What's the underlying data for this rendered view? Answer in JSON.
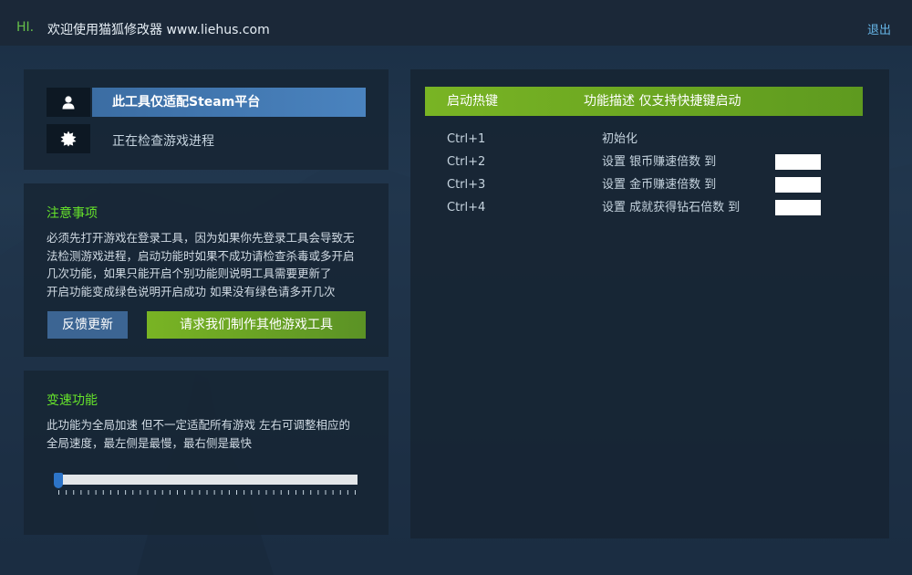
{
  "titlebar": {
    "greeting": "HI.",
    "welcome": "欢迎使用猫狐修改器 www.liehus.com",
    "exit": "退出"
  },
  "status": {
    "title": "此工具仅适配Steam平台",
    "checking": "正在检查游戏进程",
    "icons": [
      "user-icon",
      "gear-icon"
    ]
  },
  "notes": {
    "heading": "注意事项",
    "lines": [
      "必须先打开游戏在登录工具，因为如果你先登录工具会导致无",
      "法检测游戏进程，启动功能时如果不成功请检查杀毒或多开启",
      "几次功能，如果只能开启个别功能则说明工具需要更新了",
      "开启功能变成绿色说明开启成功 如果没有绿色请多开几次"
    ],
    "feedback_button": "反馈更新",
    "request_button": "请求我们制作其他游戏工具"
  },
  "speed": {
    "heading": "变速功能",
    "lines": [
      "此功能为全局加速 但不一定适配所有游戏 左右可调整相应的",
      "全局速度，最左侧是最慢，最右侧是最快"
    ],
    "slider_value": 0
  },
  "hotkeys": {
    "col_key": "启动热键",
    "col_desc": "功能描述 仅支持快捷键启动",
    "rows": [
      {
        "key": "Ctrl+1",
        "desc": "初始化",
        "has_input": false
      },
      {
        "key": "Ctrl+2",
        "desc": "设置 银币赚速倍数 到",
        "has_input": true
      },
      {
        "key": "Ctrl+3",
        "desc": "设置 金币赚速倍数 到",
        "has_input": true
      },
      {
        "key": "Ctrl+4",
        "desc": "设置 成就获得钻石倍数 到",
        "has_input": true
      }
    ]
  },
  "colors": {
    "accent_green": "#66e32b",
    "button_blue": "#3c6593",
    "button_green": "#79b424",
    "link_blue": "#66b5e6"
  }
}
